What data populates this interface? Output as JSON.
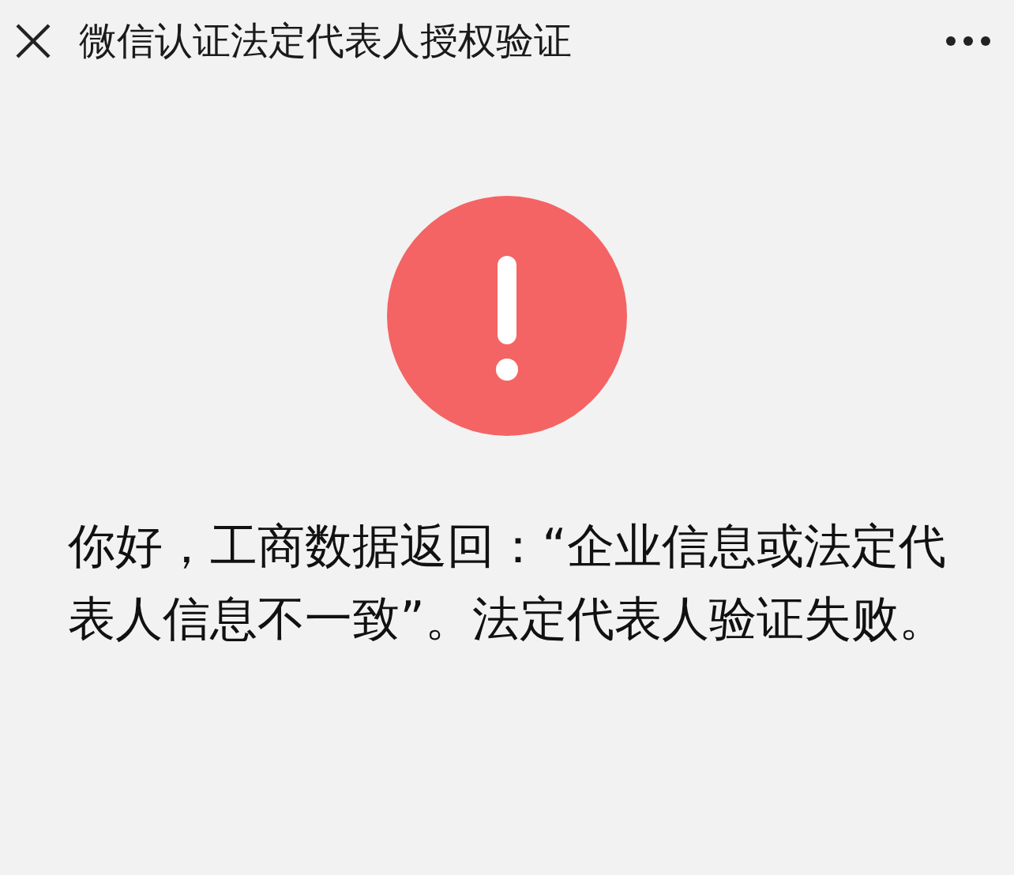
{
  "header": {
    "title": "微信认证法定代表人授权验证"
  },
  "result": {
    "kind": "error",
    "message": "你好，工商数据返回：“企业信息或法定代表人信息不一致”。法定代表人验证失败。"
  }
}
